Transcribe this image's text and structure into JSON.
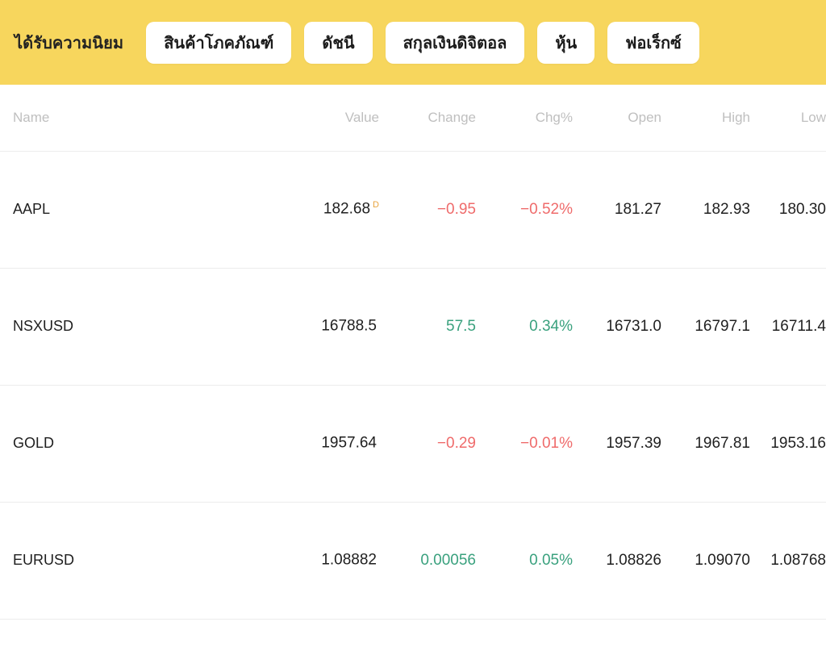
{
  "header": {
    "title": "ได้รับความนิยม",
    "background_color": "#f7d65d",
    "tabs": [
      {
        "label": "สินค้าโภคภัณฑ์"
      },
      {
        "label": "ดัชนี"
      },
      {
        "label": "สกุลเงินดิจิตอล"
      },
      {
        "label": "หุ้น"
      },
      {
        "label": "ฟอเร็กซ์"
      }
    ]
  },
  "table": {
    "columns": [
      {
        "key": "name",
        "label": "Name"
      },
      {
        "key": "value",
        "label": "Value"
      },
      {
        "key": "change",
        "label": "Change"
      },
      {
        "key": "chgp",
        "label": "Chg%"
      },
      {
        "key": "open",
        "label": "Open"
      },
      {
        "key": "high",
        "label": "High"
      },
      {
        "key": "low",
        "label": "Low"
      }
    ],
    "colors": {
      "up": "#3aa17e",
      "down": "#ef6b6b",
      "flag": "#e8a33d"
    },
    "rows": [
      {
        "name": "AAPL",
        "value": "182.68",
        "value_flag": "D",
        "change": "−0.95",
        "chgp": "−0.52%",
        "direction": "down",
        "open": "181.27",
        "high": "182.93",
        "low": "180.30"
      },
      {
        "name": "NSXUSD",
        "value": "16788.5",
        "value_flag": "",
        "change": "57.5",
        "chgp": "0.34%",
        "direction": "up",
        "open": "16731.0",
        "high": "16797.1",
        "low": "16711.4"
      },
      {
        "name": "GOLD",
        "value": "1957.64",
        "value_flag": "",
        "change": "−0.29",
        "chgp": "−0.01%",
        "direction": "down",
        "open": "1957.39",
        "high": "1967.81",
        "low": "1953.16"
      },
      {
        "name": "EURUSD",
        "value": "1.08882",
        "value_flag": "",
        "change": "0.00056",
        "chgp": "0.05%",
        "direction": "up",
        "open": "1.08826",
        "high": "1.09070",
        "low": "1.08768"
      }
    ]
  }
}
